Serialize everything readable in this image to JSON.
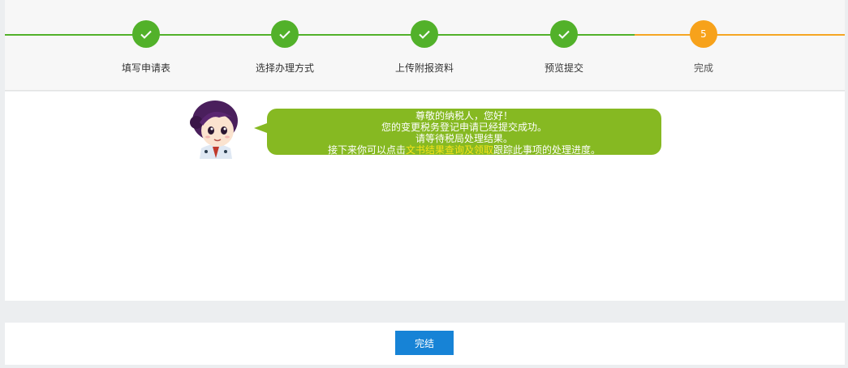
{
  "steps": [
    {
      "label": "填写申请表",
      "status": "done"
    },
    {
      "label": "选择办理方式",
      "status": "done"
    },
    {
      "label": "上传附报资料",
      "status": "done"
    },
    {
      "label": "预览提交",
      "status": "done"
    },
    {
      "label": "完成",
      "status": "current",
      "number": "5"
    }
  ],
  "message": {
    "line1": "尊敬的纳税人，您好！",
    "line2": "您的变更税务登记申请已经提交成功。",
    "line3": "请等待税局处理结果。",
    "line4_prefix": "接下来你可以点击",
    "line4_link": "文书结果查询及领取",
    "line4_suffix": "跟踪此事项的处理进度。"
  },
  "footer": {
    "finish_label": "完结"
  },
  "colors": {
    "done": "#52b12a",
    "current": "#f7a21b",
    "bubble": "#86b922",
    "link": "#f7e21a",
    "button": "#1783d6"
  },
  "icons": {
    "done_step": "check-icon"
  }
}
